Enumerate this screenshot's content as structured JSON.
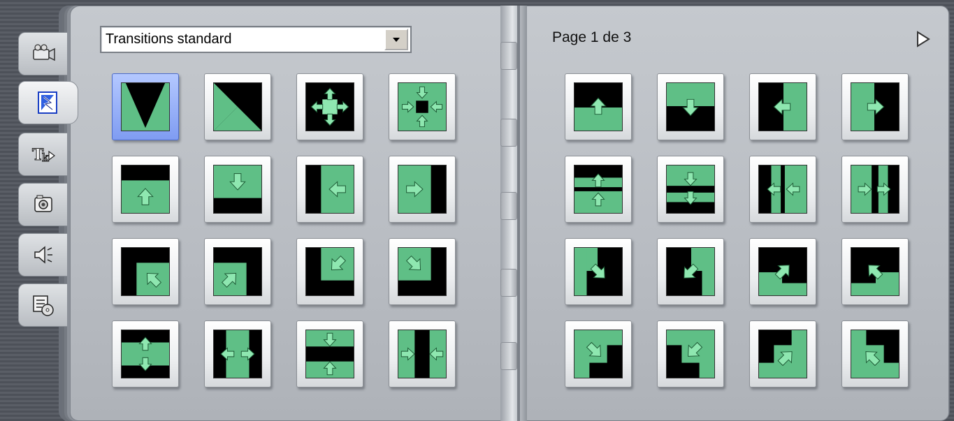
{
  "dropdown": {
    "selected": "Transitions standard"
  },
  "pagination": {
    "label": "Page 1 de 3"
  },
  "tabs": [
    {
      "icon": "video-camera-icon"
    },
    {
      "icon": "transitions-icon",
      "active": true
    },
    {
      "icon": "title-icon"
    },
    {
      "icon": "photo-icon"
    },
    {
      "icon": "sound-effects-icon"
    },
    {
      "icon": "disc-menu-icon"
    }
  ],
  "colors": {
    "green": "#5fbf86",
    "dark": "#000000",
    "arrow": "#8ee7b0",
    "selection": "#8aa6f5"
  },
  "left_thumbnails": [
    "wipe-v-down",
    "wipe-diamond",
    "arrows-out-cross",
    "arrows-in-cross",
    "wipe-up-from-bottom",
    "wipe-down-from-top",
    "wipe-left-from-right",
    "wipe-right-from-left",
    "wipe-up-left-corner",
    "wipe-up-right-corner",
    "wipe-down-left-corner",
    "wipe-down-right-corner",
    "split-vertical-open",
    "split-horizontal-open",
    "split-vertical-close",
    "split-horizontal-close"
  ],
  "right_thumbnails": [
    "push-up",
    "push-down",
    "push-left",
    "push-right",
    "split-push-vertical",
    "split-push-vertical-in",
    "split-push-horizontal-in",
    "split-push-horizontal-out",
    "corner-push-down-right",
    "corner-push-down-left",
    "corner-push-up-right",
    "corner-push-up-left",
    "corner-reveal-down-right",
    "corner-reveal-down-left",
    "corner-reveal-up-right",
    "corner-reveal-up-left"
  ]
}
